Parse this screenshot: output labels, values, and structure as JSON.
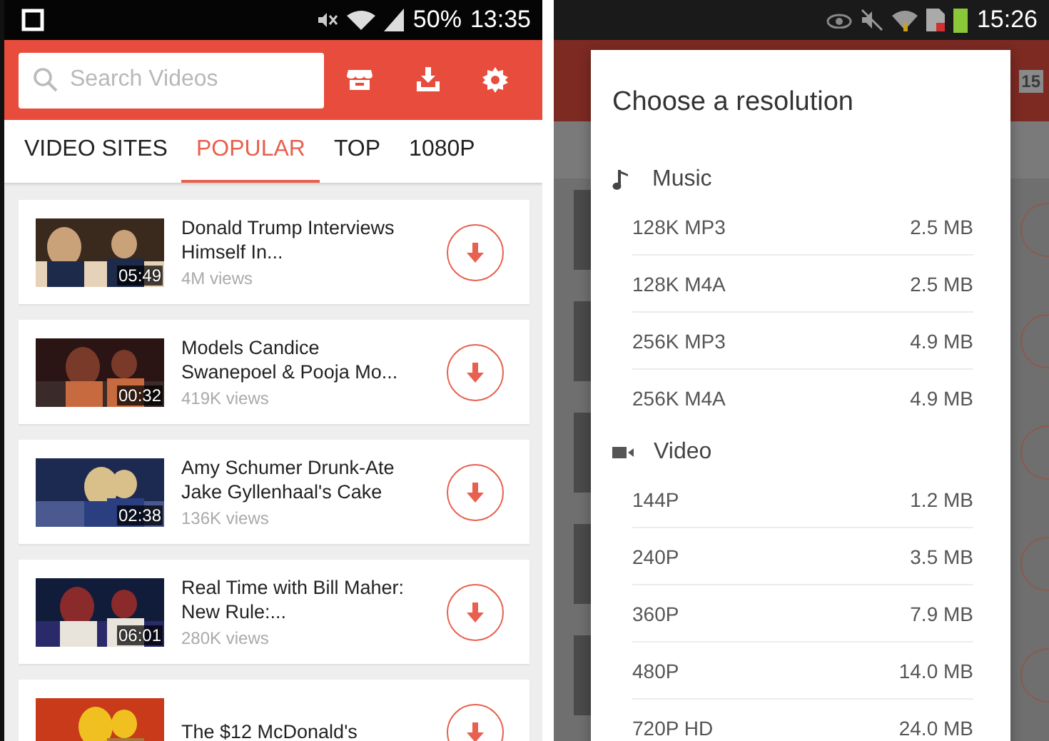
{
  "left_phone": {
    "status_bar": {
      "battery": "50%",
      "time": "13:35"
    },
    "search": {
      "placeholder": "Search Videos"
    },
    "tabs": [
      {
        "label": "VIDEO SITES",
        "selected": false
      },
      {
        "label": "POPULAR",
        "selected": true
      },
      {
        "label": "TOP",
        "selected": false
      },
      {
        "label": "1080P",
        "selected": false
      }
    ],
    "videos": [
      {
        "title": "Donald Trump Interviews Himself In...",
        "duration": "05:49",
        "views": "4M views"
      },
      {
        "title": "Models Candice Swanepoel & Pooja Mo...",
        "duration": "00:32",
        "views": "419K views"
      },
      {
        "title": "Amy Schumer Drunk-Ate Jake Gyllenhaal's Cake",
        "duration": "02:38",
        "views": "136K views"
      },
      {
        "title": "Real Time with Bill Maher: New Rule:...",
        "duration": "06:01",
        "views": "280K views"
      },
      {
        "title": "The $12 McDonald's"
      }
    ]
  },
  "right_phone": {
    "status_bar": {
      "time": "15:26"
    },
    "background": {
      "badge": "15"
    },
    "dialog": {
      "title": "Choose a resolution",
      "sections": [
        {
          "kind": "music",
          "label": "Music",
          "options": [
            {
              "label": "128K MP3",
              "size": "2.5 MB"
            },
            {
              "label": "128K M4A",
              "size": "2.5 MB"
            },
            {
              "label": "256K MP3",
              "size": "4.9 MB"
            },
            {
              "label": "256K M4A",
              "size": "4.9 MB"
            }
          ]
        },
        {
          "kind": "video",
          "label": "Video",
          "options": [
            {
              "label": "144P",
              "size": "1.2 MB"
            },
            {
              "label": "240P",
              "size": "3.5 MB"
            },
            {
              "label": "360P",
              "size": "7.9 MB"
            },
            {
              "label": "480P",
              "size": "14.0 MB"
            },
            {
              "label": "720P HD",
              "size": "24.0 MB"
            }
          ]
        }
      ]
    }
  }
}
